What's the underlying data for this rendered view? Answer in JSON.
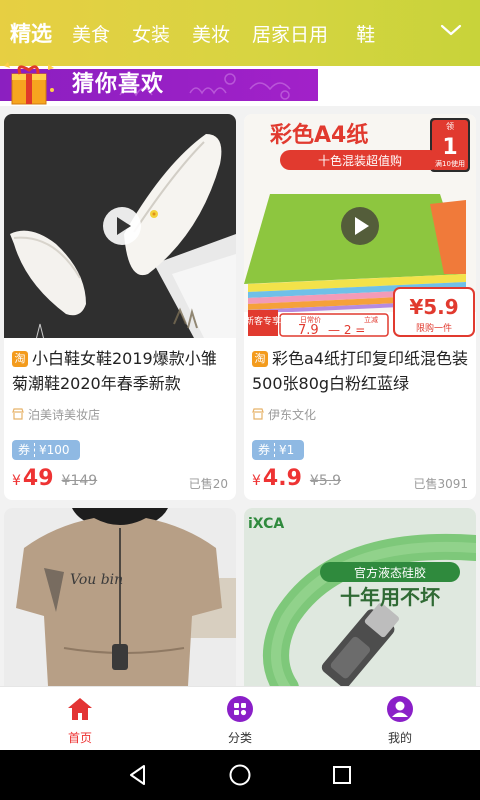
{
  "topbar": {
    "tabs": [
      "精选",
      "美食",
      "女装",
      "美妆",
      "居家日用",
      "鞋"
    ],
    "active_tab": 0,
    "more_icon": "chevron-down-icon"
  },
  "banner": {
    "title": "猜你喜欢",
    "icon": "gift-bag-icon"
  },
  "products": [
    {
      "title": "小白鞋女鞋2019爆款小雏菊潮鞋2020年春季新款",
      "platform_badge": "淘",
      "shop": "泊美诗美妆店",
      "coupon_prefix": "券",
      "coupon_value": "¥100",
      "price_symbol": "¥",
      "price": "49",
      "original_price": "¥149",
      "sold": "已售20"
    },
    {
      "title": "彩色a4纸打印复印纸混色装500张80g白粉红蓝绿",
      "platform_badge": "淘",
      "shop": "伊东文化",
      "coupon_prefix": "券",
      "coupon_value": "¥1",
      "price_symbol": "¥",
      "price": "4.9",
      "original_price": "¥5.9",
      "sold": "已售3091",
      "image_text": {
        "headline": "彩色A4纸",
        "sub": "十色混装超值购",
        "tag_top": "领",
        "tag_num": "1",
        "tag_bottom": "满10使用",
        "promo_left": "新客专享",
        "promo_daily_label": "日常价",
        "promo_daily": "7.9",
        "promo_minus": "— 2 =",
        "promo_off_label": "立减",
        "promo_final": "¥5.9",
        "promo_limit": "限购一件"
      }
    },
    {
      "title": "",
      "image_text": {
        "shirt": "Vou bin"
      }
    },
    {
      "title": "",
      "image_text": {
        "brand": "iXCA",
        "badge": "官方液态硅胶",
        "slogan": "十年用不坏"
      }
    }
  ],
  "bottom_nav": [
    {
      "label": "首页",
      "icon": "home-icon",
      "active": true
    },
    {
      "label": "分类",
      "icon": "category-icon",
      "active": false
    },
    {
      "label": "我的",
      "icon": "user-icon",
      "active": false
    }
  ],
  "colors": {
    "accent": "#e33333",
    "topbar": "#d9d140",
    "banner": "#9a20c8",
    "coupon": "#8fb9e3"
  }
}
